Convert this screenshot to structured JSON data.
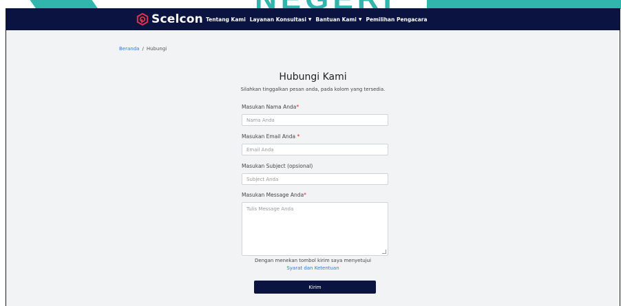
{
  "watermark": {
    "text": "NEGERI"
  },
  "navbar": {
    "brand": "Scelcon",
    "items": [
      {
        "label": "Tentang Kami",
        "has_dropdown": false
      },
      {
        "label": "Layanan Konsultasi",
        "has_dropdown": true
      },
      {
        "label": "Bantuan Kami",
        "has_dropdown": true
      },
      {
        "label": "Pemilihan Pengacara",
        "has_dropdown": false
      }
    ]
  },
  "breadcrumb": {
    "home": "Beranda",
    "separator": "/",
    "current": "Hubungi"
  },
  "form": {
    "title": "Hubungi Kami",
    "subtitle": "Silahkan tinggalkan pesan anda, pada kolom yang tersedia.",
    "name": {
      "label": "Masukan Nama Anda",
      "required_mark": "*",
      "placeholder": "Nama Anda"
    },
    "email": {
      "label": "Masukan Email Anda ",
      "required_mark": "*",
      "placeholder": "Email Anda"
    },
    "subject": {
      "label": "Masukan Subject (opsional)",
      "placeholder": "Subject Anda"
    },
    "message": {
      "label": "Masukan Message Anda",
      "required_mark": "*",
      "placeholder": "Tulis Message Anda"
    },
    "consent_text": "Dengan menekan tombol kirim saya menyetujui",
    "terms_link": "Syarat dan Ketentuan",
    "submit_label": "Kirim"
  },
  "colors": {
    "navbar_bg": "#0b1440",
    "page_bg": "#f1f3f4",
    "link": "#2b7be0",
    "required": "#e02424",
    "brand_logo": "#e0334a"
  },
  "icons": {
    "brand_logo": "hexagon-logo-icon",
    "dropdown": "caret-down-icon"
  }
}
